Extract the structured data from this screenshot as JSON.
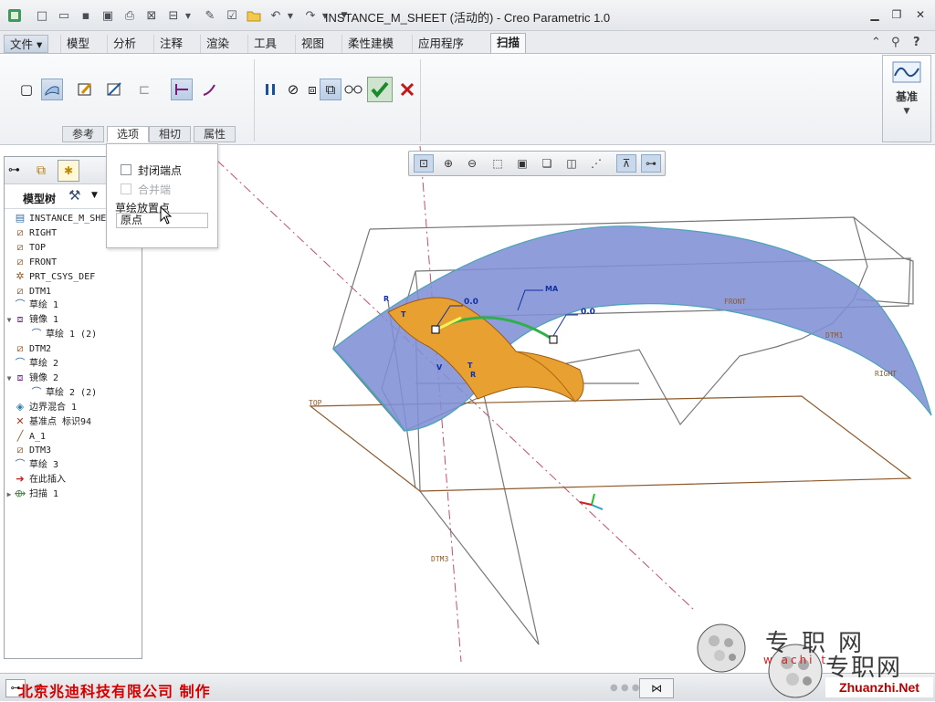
{
  "window": {
    "title": "INSTANCE_M_SHEET (活动的) - Creo Parametric 1.0"
  },
  "ribbon": {
    "file_tab": "文件 ▾",
    "tabs": [
      "模型",
      "分析",
      "注释",
      "渲染",
      "工具",
      "视图",
      "柔性建模",
      "应用程序",
      "扫描"
    ],
    "active_tab": "扫描",
    "sub_tabs": [
      "参考",
      "选项",
      "相切",
      "属性"
    ],
    "active_sub_tab": "选项",
    "datum_label": "基准"
  },
  "options_panel": {
    "close_ends_label": "封闭端点",
    "merge_ends_label": "合并端",
    "sketch_placement_label": "草绘放置点",
    "sketch_placement_value": "原点"
  },
  "model_tree": {
    "title": "模型树",
    "items": [
      {
        "label": "INSTANCE_M_SHEE",
        "icon": "part-icon",
        "expander": ""
      },
      {
        "label": "RIGHT",
        "icon": "datum-plane-icon",
        "expander": ""
      },
      {
        "label": "TOP",
        "icon": "datum-plane-icon",
        "expander": ""
      },
      {
        "label": "FRONT",
        "icon": "datum-plane-icon",
        "expander": ""
      },
      {
        "label": "PRT_CSYS_DEF",
        "icon": "csys-icon",
        "expander": ""
      },
      {
        "label": "DTM1",
        "icon": "datum-plane-icon",
        "expander": ""
      },
      {
        "label": "草绘 1",
        "icon": "sketch-icon",
        "expander": ""
      },
      {
        "label": "镜像 1",
        "icon": "mirror-icon",
        "expander": "▼"
      },
      {
        "label": "草绘 1 (2)",
        "icon": "sketch-icon",
        "expander": "",
        "indent": true
      },
      {
        "label": "DTM2",
        "icon": "datum-plane-icon",
        "expander": ""
      },
      {
        "label": "草绘 2",
        "icon": "sketch-icon",
        "expander": ""
      },
      {
        "label": "镜像 2",
        "icon": "mirror-icon",
        "expander": "▼"
      },
      {
        "label": "草绘 2 (2)",
        "icon": "sketch-icon",
        "expander": "",
        "indent": true
      },
      {
        "label": "边界混合 1",
        "icon": "boundary-blend-icon",
        "expander": ""
      },
      {
        "label": "基准点 标识94",
        "icon": "datum-point-icon",
        "expander": ""
      },
      {
        "label": "A_1",
        "icon": "datum-axis-icon",
        "expander": ""
      },
      {
        "label": "DTM3",
        "icon": "datum-plane-icon",
        "expander": ""
      },
      {
        "label": "草绘 3",
        "icon": "sketch-icon",
        "expander": ""
      },
      {
        "label": "在此插入",
        "icon": "insert-arrow-icon",
        "expander": ""
      },
      {
        "label": "扫描 1",
        "icon": "sweep-icon",
        "expander": "▶"
      }
    ]
  },
  "viewport": {
    "plane_labels": {
      "top": "TOP",
      "front": "FRONT",
      "dtm1": "DTM1",
      "right": "RIGHT",
      "dtm3": "DTM3"
    },
    "dimensions": [
      "0.0",
      "0.0",
      "MA"
    ],
    "markers": [
      "R",
      "T",
      "V",
      "R",
      "T"
    ]
  },
  "statusbar": {
    "company": "北京兆迪科技有限公司    制作"
  },
  "watermark": {
    "line1": "专职网",
    "line2": "专职网",
    "url": "Zhuanzhi.Net",
    "partial": "w  achi  t"
  },
  "colors": {
    "accent_blue": "#7f8fd6",
    "sweep_orange": "#e8a030",
    "brand_red": "#d40000",
    "plane_brown": "#8c5a2b",
    "dashed_red": "#c0506a"
  }
}
